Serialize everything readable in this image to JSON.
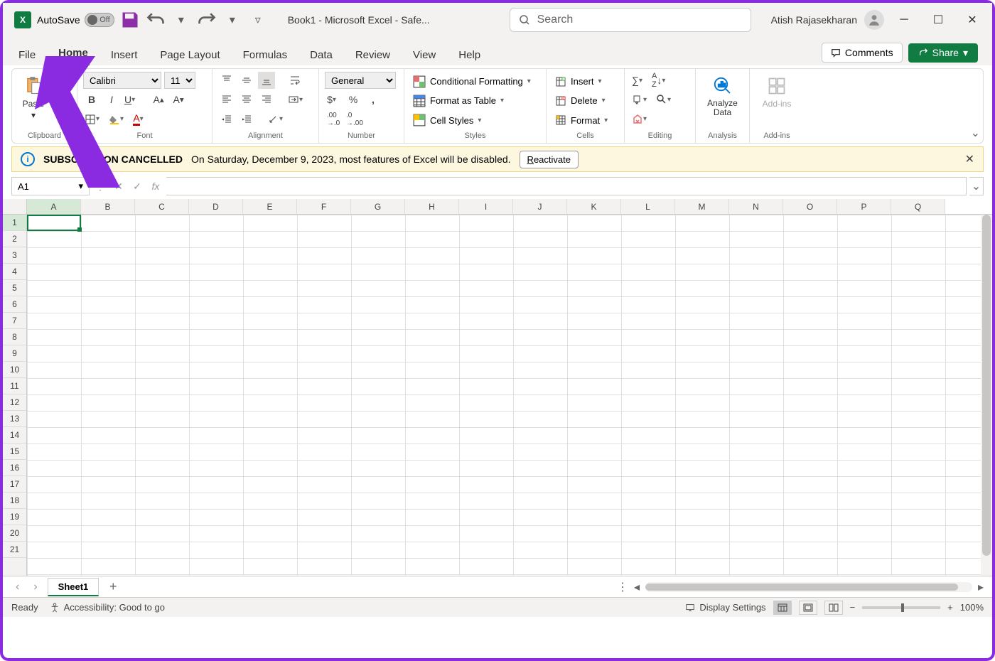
{
  "titlebar": {
    "autosave_label": "AutoSave",
    "autosave_state": "Off",
    "document_title": "Book1  -  Microsoft Excel  -  Safe...",
    "search_placeholder": "Search",
    "user_name": "Atish Rajasekharan"
  },
  "tabs": [
    "File",
    "Home",
    "Insert",
    "Page Layout",
    "Formulas",
    "Data",
    "Review",
    "View",
    "Help"
  ],
  "active_tab": "Home",
  "ribbon_right": {
    "comments": "Comments",
    "share": "Share"
  },
  "ribbon": {
    "clipboard": {
      "paste": "Paste",
      "label": "Clipboard"
    },
    "font": {
      "name": "Calibri",
      "size": "11",
      "label": "Font"
    },
    "alignment": {
      "label": "Alignment"
    },
    "number": {
      "format": "General",
      "label": "Number"
    },
    "styles": {
      "cond": "Conditional Formatting",
      "table": "Format as Table",
      "cell": "Cell Styles",
      "label": "Styles"
    },
    "cells": {
      "insert": "Insert",
      "delete": "Delete",
      "format": "Format",
      "label": "Cells"
    },
    "editing": {
      "label": "Editing"
    },
    "analysis": {
      "analyze": "Analyze Data",
      "label": "Analysis"
    },
    "addins": {
      "addins": "Add-ins",
      "label": "Add-ins"
    }
  },
  "warning": {
    "title": "SUBSCRIPTION CANCELLED",
    "text": "On Saturday, December 9, 2023, most features of Excel will be disabled.",
    "button": "Reactivate"
  },
  "formula_bar": {
    "name_box": "A1"
  },
  "columns": [
    "A",
    "B",
    "C",
    "D",
    "E",
    "F",
    "G",
    "H",
    "I",
    "J",
    "K",
    "L",
    "M",
    "N",
    "O",
    "P",
    "Q"
  ],
  "rows": [
    "1",
    "2",
    "3",
    "4",
    "5",
    "6",
    "7",
    "8",
    "9",
    "10",
    "11",
    "12",
    "13",
    "14",
    "15",
    "16",
    "17",
    "18",
    "19",
    "20",
    "21"
  ],
  "active_cell": "A1",
  "sheets": {
    "active": "Sheet1"
  },
  "statusbar": {
    "ready": "Ready",
    "accessibility": "Accessibility: Good to go",
    "display": "Display Settings",
    "zoom": "100%"
  }
}
